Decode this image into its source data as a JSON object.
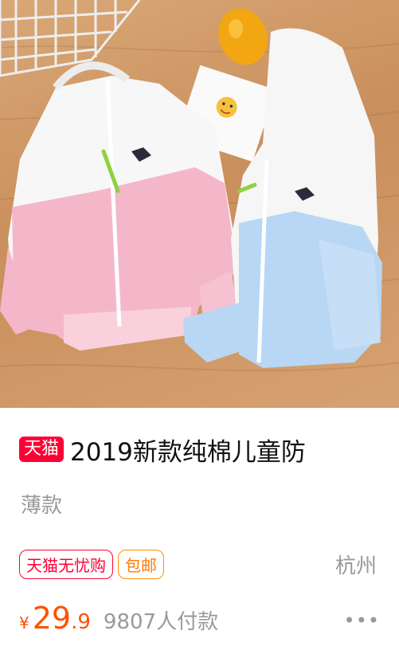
{
  "product": {
    "image_alt": "product-photo",
    "badge": "天猫",
    "title": "2019新款纯棉儿童防",
    "subtitle": "薄款",
    "service_tags": [
      "天猫无忧购",
      "包邮"
    ],
    "location": "杭州",
    "currency": "¥",
    "price_int": "29",
    "price_dec": ".9",
    "sales": "9807人付款",
    "more": "•••"
  },
  "colors": {
    "accent_red": "#ff0036",
    "price_orange": "#ff5000",
    "free_shipping_orange": "#ff9000",
    "muted_gray": "#999999"
  }
}
